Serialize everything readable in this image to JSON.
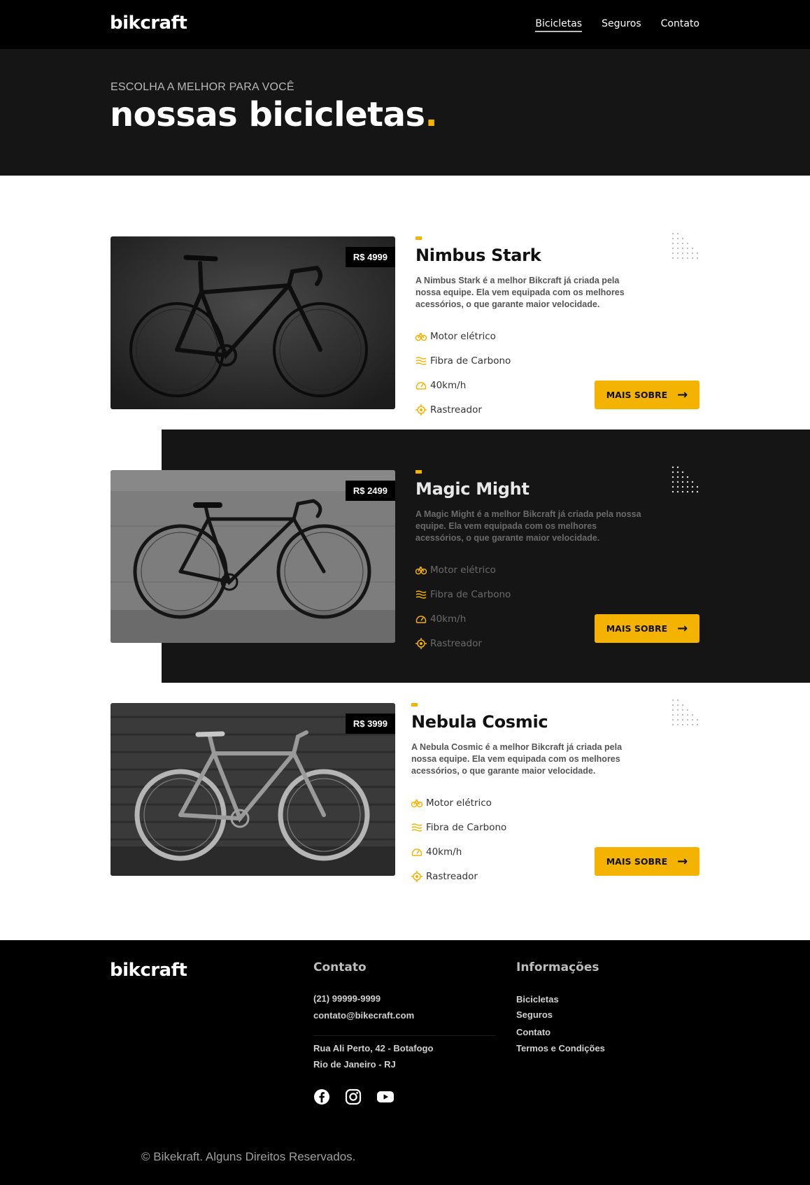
{
  "header": {
    "logo": "bikcraft",
    "nav": [
      {
        "label": "Bicicletas"
      },
      {
        "label": "Seguros"
      },
      {
        "label": "Contato"
      }
    ]
  },
  "hero": {
    "subtitle": "ESCOLHA A MELHOR PARA VOCÊ",
    "title": "nossas bicicletas",
    "title_dot": "."
  },
  "colors": {
    "accent": "#f5b301",
    "dark": "#151515",
    "black": "#000000"
  },
  "bikes": [
    {
      "name": "Nimbus Stark",
      "price": "R$ 4999",
      "description": "A Nimbus Stark é a melhor Bikcraft já criada pela nossa equipe. Ela vem equipada com os melhores acessórios, o que garante maior velocidade.",
      "features": [
        "Motor elétrico",
        "Fibra de Carbono",
        "40km/h",
        "Rastreador"
      ],
      "button": "MAIS SOBRE"
    },
    {
      "name": "Magic Might",
      "price": "R$ 2499",
      "description": "A Magic Might é a melhor Bikcraft já criada pela nossa equipe. Ela vem equipada com os melhores acessórios, o que garante maior velocidade.",
      "features": [
        "Motor elétrico",
        "Fibra de Carbono",
        "40km/h",
        "Rastreador"
      ],
      "button": "MAIS SOBRE"
    },
    {
      "name": "Nebula Cosmic",
      "price": "R$ 3999",
      "description": "A Nebula Cosmic é a melhor Bikcraft já criada pela nossa equipe. Ela vem equipada com os melhores acessórios, o que garante maior velocidade.",
      "features": [
        "Motor elétrico",
        "Fibra de Carbono",
        "40km/h",
        "Rastreador"
      ],
      "button": "MAIS SOBRE"
    }
  ],
  "footer": {
    "logo": "bikcraft",
    "contact_title": "Contato",
    "phone": "(21)  99999-9999",
    "email": "contato@bikecraft.com",
    "address_line1": "Rua Ali Perto, 42 - Botafogo",
    "address_line2": "Rio de Janeiro - RJ",
    "info_title": "Informações",
    "info_links": [
      "Bicicletas",
      "Seguros",
      "Contato",
      "Termos e Condições"
    ],
    "social_icons": [
      "facebook-icon",
      "instagram-icon",
      "youtube-icon"
    ],
    "copyright": "© Bikekraft. Alguns Direitos Reservados."
  }
}
